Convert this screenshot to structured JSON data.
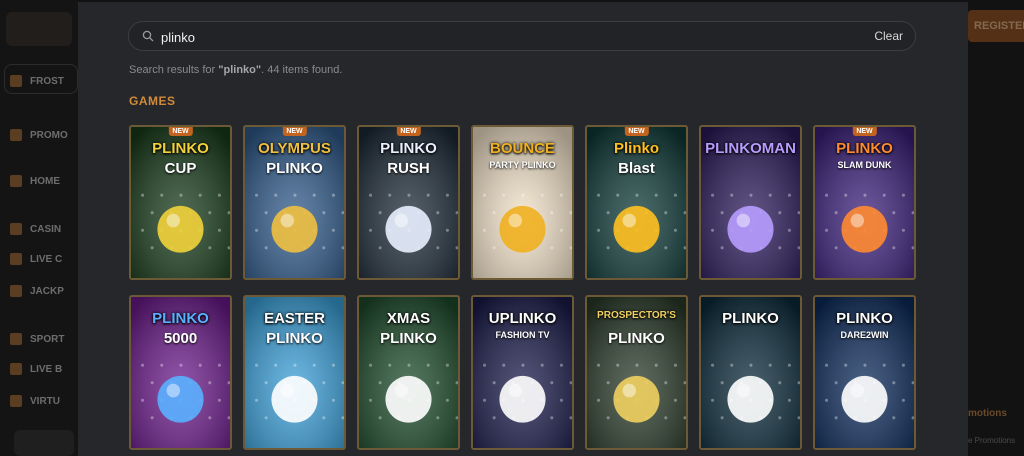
{
  "background": {
    "sidebar_items": [
      "FROST",
      "PROMO",
      "HOME",
      "CASIN",
      "LIVE C",
      "JACKP",
      "SPORT",
      "LIVE B",
      "VIRTU"
    ],
    "register_label": "REGISTER",
    "promo_label": "motions",
    "promo_sub": "e Promotions"
  },
  "search": {
    "value": "plinko",
    "clear_label": "Clear"
  },
  "results": {
    "prefix": "Search results for ",
    "query": "\"plinko\"",
    "suffix": ". 44 items found."
  },
  "section": {
    "title": "GAMES"
  },
  "new_badge": "NEW",
  "games": [
    {
      "title": "PLINKO",
      "title2": "CUP",
      "new": true,
      "bg": "#173a1a",
      "accent": "#f2d23a"
    },
    {
      "title": "OLYMPUS",
      "title2": "PLINKO",
      "new": true,
      "bg": "#2f5a8a",
      "accent": "#f0c040"
    },
    {
      "title": "PLINKO",
      "title2": "RUSH",
      "new": true,
      "bg": "#1c2a36",
      "accent": "#e8f0ff"
    },
    {
      "title": "BOUNCE",
      "title2": "PARTY PLINKO",
      "new": false,
      "bg": "#f2e2c8",
      "accent": "#f0b020"
    },
    {
      "title": "Plinko",
      "title2": "Blast",
      "new": true,
      "bg": "#0e3a38",
      "accent": "#ffc020"
    },
    {
      "title": "PLINKOMAN",
      "title2": "",
      "new": false,
      "bg": "#2a1a5a",
      "accent": "#b79cff"
    },
    {
      "title": "PLINKO",
      "title2": "SLAM DUNK",
      "new": true,
      "bg": "#3a1f7a",
      "accent": "#ff8a30"
    },
    {
      "title": "PLINKO",
      "title2": "5000",
      "new": false,
      "bg": "#6a1a8a",
      "accent": "#5ab0ff"
    },
    {
      "title": "EASTER",
      "title2": "PLINKO",
      "new": false,
      "bg": "#3a9fd8",
      "accent": "#ffffff"
    },
    {
      "title": "XMAS",
      "title2": "PLINKO",
      "new": false,
      "bg": "#1c4a2a",
      "accent": "#ffffff"
    },
    {
      "title": "UPLINKO",
      "title2": "FASHION TV",
      "new": false,
      "bg": "#1a1a4a",
      "accent": "#ffffff"
    },
    {
      "title": "PROSPECTOR'S",
      "title2": "PLINKO",
      "new": false,
      "bg": "#2a3a2a",
      "accent": "#f0d060"
    },
    {
      "title": "PLINKO",
      "title2": "",
      "new": false,
      "bg": "#0a2a3a",
      "accent": "#ffffff"
    },
    {
      "title": "PLINKO",
      "title2": "DARE2WIN",
      "new": false,
      "bg": "#0c2a5a",
      "accent": "#ffffff"
    }
  ],
  "colors": {
    "modal_bg": "#26272a",
    "tile_border": "#6b5a35",
    "section_title": "#d18a3a",
    "new_badge": "#c2641f"
  }
}
